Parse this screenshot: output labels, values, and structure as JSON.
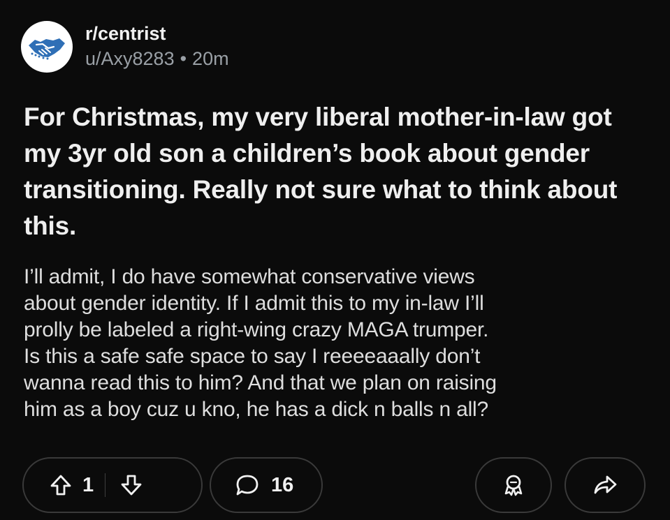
{
  "subreddit": "r/centrist",
  "author": "u/Axy8283",
  "separator": "•",
  "age": "20m",
  "post": {
    "title": "For Christmas, my very liberal mother-in-law got my 3yr old son a children’s book about gender transitioning. Really not sure what to think about this.",
    "body": "I’ll admit, I do have somewhat conservative views\nabout gender identity. If I admit this to my in-law I’ll\nprolly be labeled a right-wing crazy MAGA trumper.\nIs this a safe safe space to say I reeeeaaally don’t\nwanna read this to him? And that we plan on raising\nhim as a boy cuz u kno, he has a dick n balls n all?"
  },
  "actions": {
    "upvotes": "1",
    "comments": "16"
  },
  "colors": {
    "background": "#0b0b0b",
    "text": "#efefef",
    "muted": "#9aa0a6",
    "border": "#3a3a3a",
    "avatar_blue": "#2f6fb6"
  },
  "icons": {
    "avatar": "handshake-icon",
    "upvote": "arrow-up-icon",
    "downvote": "arrow-down-icon",
    "comment": "speech-bubble-icon",
    "award": "award-icon",
    "share": "share-arrow-icon"
  }
}
